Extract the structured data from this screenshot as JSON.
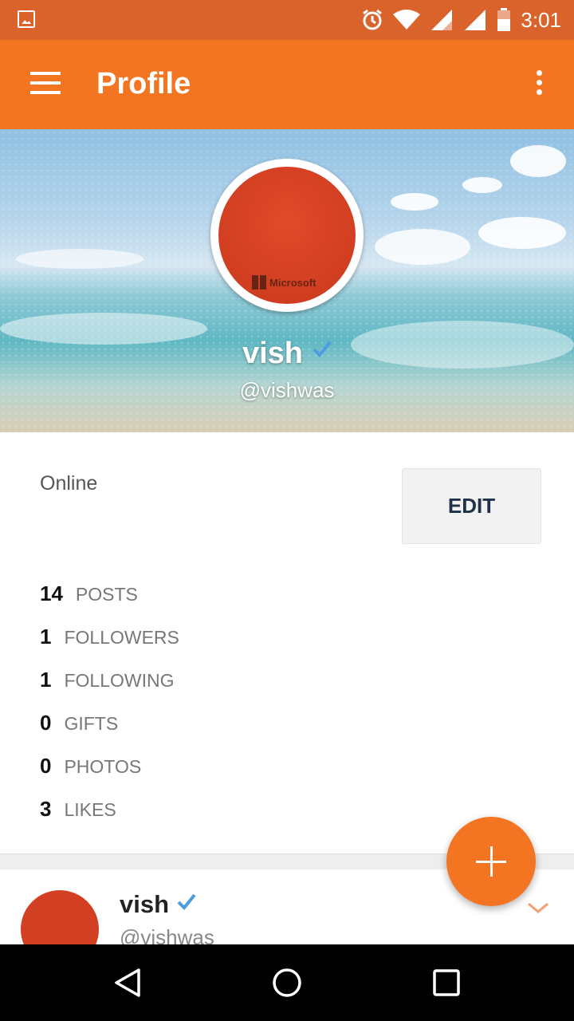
{
  "status_bar": {
    "time": "3:01",
    "icons": [
      "image-icon",
      "alarm-icon",
      "wifi-icon",
      "signal-icon",
      "signal-icon",
      "battery-icon"
    ]
  },
  "app_bar": {
    "title": "Profile",
    "menu_icon": "menu-icon",
    "more_icon": "more-vert-icon"
  },
  "profile": {
    "name": "vish",
    "handle": "@vishwas",
    "verified": true,
    "avatar_text": "Microsoft"
  },
  "status": {
    "label": "Online",
    "edit_label": "EDIT"
  },
  "stats": [
    {
      "count": "14",
      "label": "POSTS"
    },
    {
      "count": "1",
      "label": "FOLLOWERS"
    },
    {
      "count": "1",
      "label": "FOLLOWING"
    },
    {
      "count": "0",
      "label": "GIFTS"
    },
    {
      "count": "0",
      "label": "PHOTOS"
    },
    {
      "count": "3",
      "label": "LIKES"
    }
  ],
  "post_card": {
    "name": "vish",
    "handle": "@vishwas"
  },
  "fab": {
    "icon": "plus-icon"
  },
  "colors": {
    "accent": "#f47521",
    "status_bar": "#d9632a",
    "verified": "#4a9de0"
  }
}
